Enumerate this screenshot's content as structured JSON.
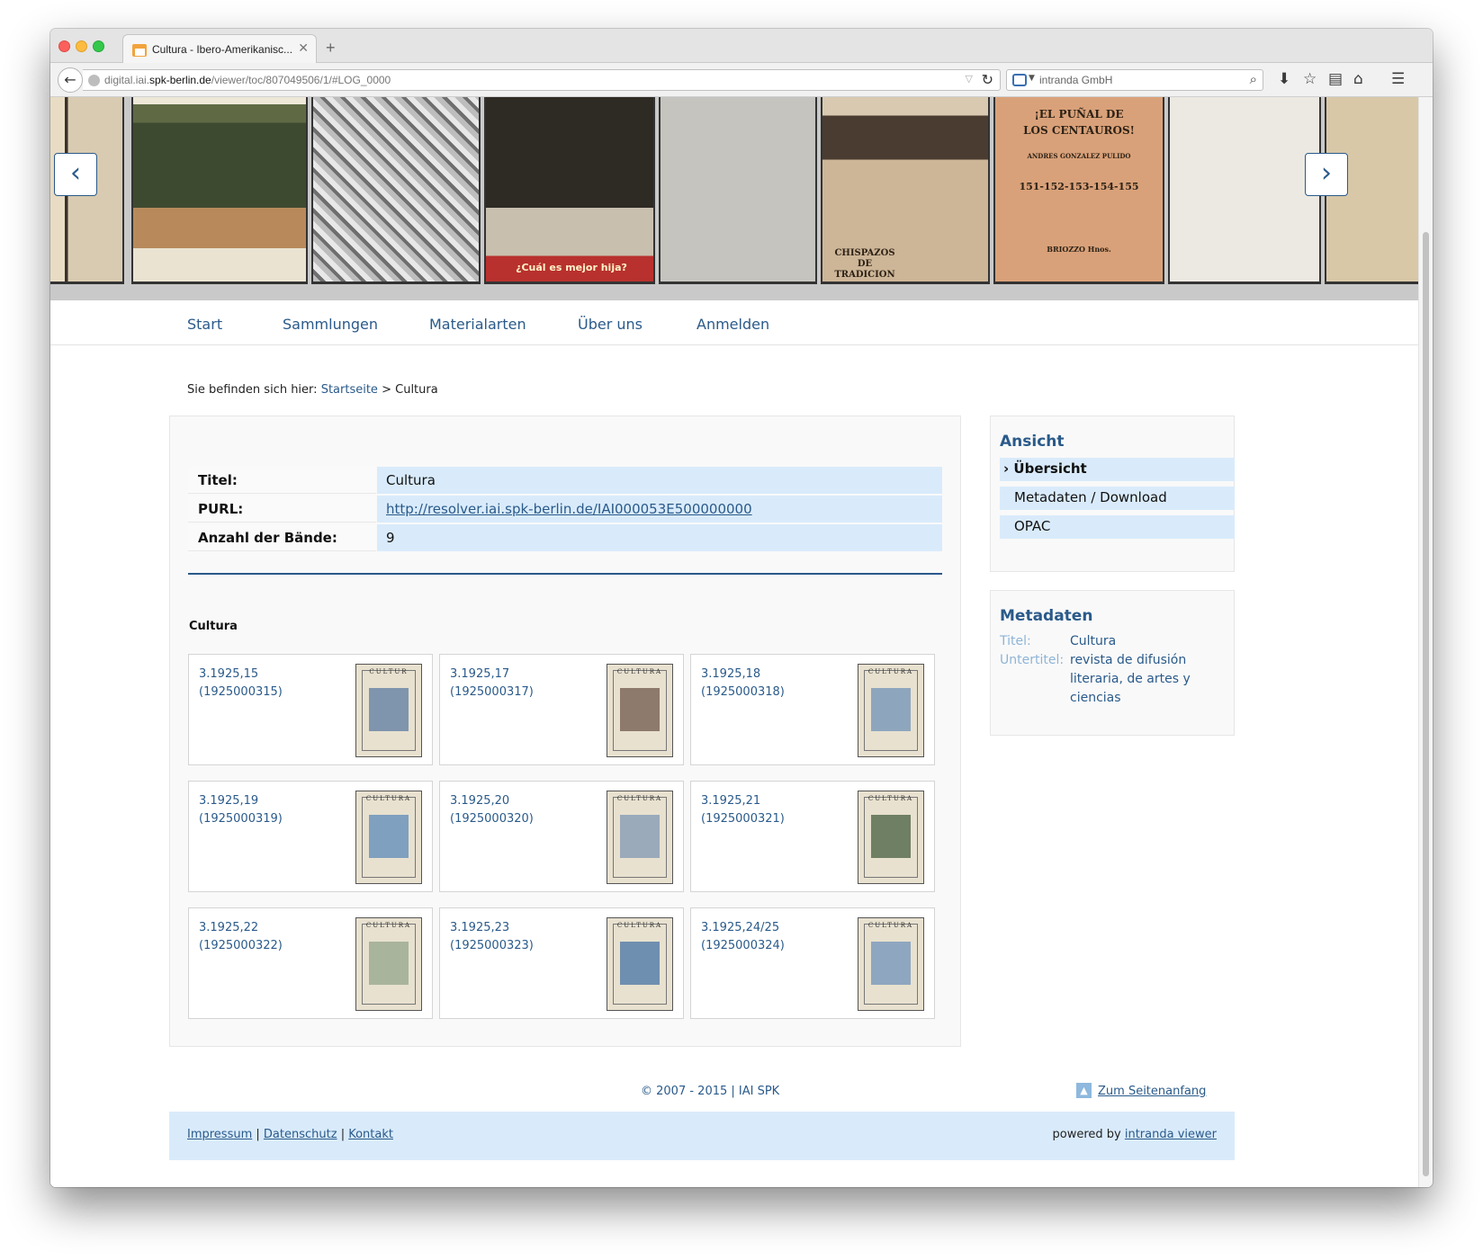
{
  "browser": {
    "tab_title": "Cultura - Ibero-Amerikanisc...",
    "url_prefix": "digital.iai.",
    "url_domain": "spk-berlin.de",
    "url_path": "/viewer/toc/807049506/1/#LOG_0000",
    "search_placeholder": "intranda GmbH"
  },
  "carousel": {
    "thumb6_lines": [
      "¡EL PUÑAL DE",
      "LOS CENTAUROS!",
      "ANDRES GONZALEZ PULIDO",
      "151-152-153-154-155",
      "BRIOZZO Hnos."
    ],
    "thumb5_caption": "CHISPAZOS DE TRADICION",
    "thumb3_caption": "¿Cuál es mejor hija?"
  },
  "nav": {
    "items": [
      "Start",
      "Sammlungen",
      "Materialarten",
      "Über uns",
      "Anmelden"
    ]
  },
  "breadcrumb": {
    "prefix": "Sie befinden sich hier:",
    "home": "Startseite",
    "separator": ">",
    "current": "Cultura"
  },
  "metadata_table": [
    {
      "label": "Titel:",
      "value": "Cultura"
    },
    {
      "label": "PURL:",
      "value": "http://resolver.iai.spk-berlin.de/IAI000053E500000000"
    },
    {
      "label": "Anzahl der Bände:",
      "value": "9"
    }
  ],
  "section_title": "Cultura",
  "volumes": [
    {
      "number": "3.1925,15",
      "id": "(1925000315)",
      "masthead": "CULTUR",
      "color": "#7f95ad"
    },
    {
      "number": "3.1925,17",
      "id": "(1925000317)",
      "masthead": "CULTURA",
      "color": "#8d7a6c"
    },
    {
      "number": "3.1925,18",
      "id": "(1925000318)",
      "masthead": "CULTURA",
      "color": "#8ea6bd"
    },
    {
      "number": "3.1925,19",
      "id": "(1925000319)",
      "masthead": "CULTURA",
      "color": "#7fa0bf"
    },
    {
      "number": "3.1925,20",
      "id": "(1925000320)",
      "masthead": "CULTURA",
      "color": "#9aaabb"
    },
    {
      "number": "3.1925,21",
      "id": "(1925000321)",
      "masthead": "CULTURA",
      "color": "#6f7f63"
    },
    {
      "number": "3.1925,22",
      "id": "(1925000322)",
      "masthead": "CULTURA",
      "color": "#a9b49c"
    },
    {
      "number": "3.1925,23",
      "id": "(1925000323)",
      "masthead": "CULTURA",
      "color": "#6f8fb0"
    },
    {
      "number": "3.1925,24/25",
      "id": "(1925000324)",
      "masthead": "CULTURA",
      "color": "#8ea6c0"
    }
  ],
  "sidebar": {
    "view_title": "Ansicht",
    "view_items": [
      "Übersicht",
      "Metadaten / Download",
      "OPAC"
    ],
    "meta_title": "Metadaten",
    "meta_fields": [
      {
        "key": "Titel:",
        "value": "Cultura"
      },
      {
        "key": "Untertitel:",
        "value": "revista de difusión literaria, de artes y ciencias"
      }
    ]
  },
  "footer": {
    "copyright": "© 2007 - 2015 | IAI SPK",
    "to_top": "Zum Seitenanfang",
    "links": [
      "Impressum",
      "Datenschutz",
      "Kontakt"
    ],
    "powered_prefix": "powered by",
    "powered_link": "intranda viewer"
  },
  "colors": {
    "accent": "#2a5a8a",
    "highlight": "#d9ebfb"
  }
}
